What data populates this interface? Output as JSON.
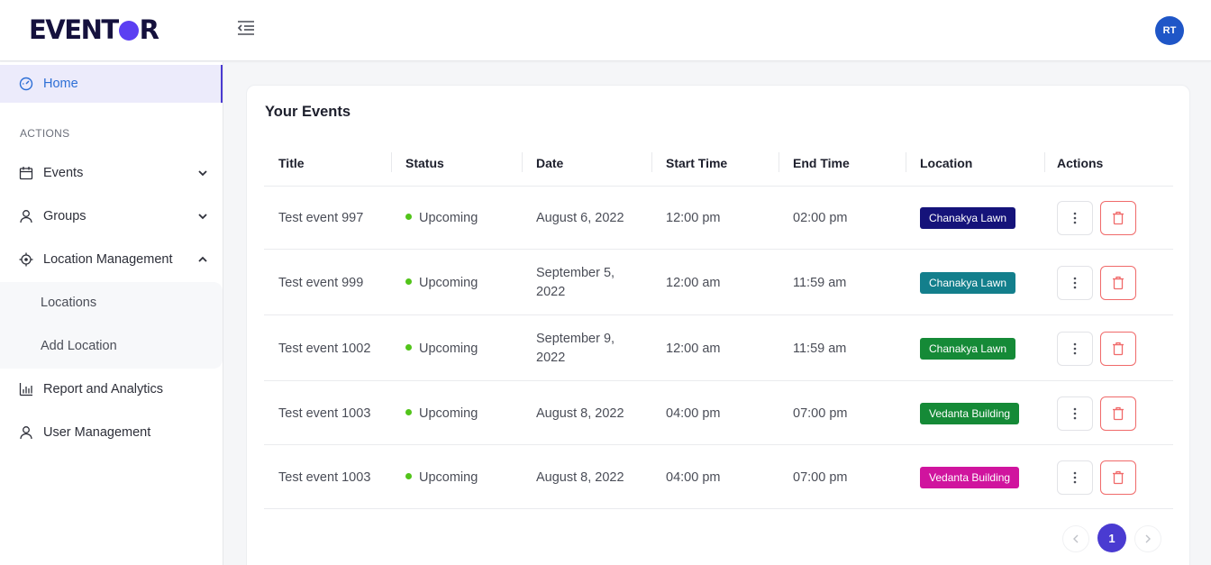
{
  "app": {
    "logo_text_a": "EVENT",
    "logo_text_b": "R",
    "avatar_initials": "RT"
  },
  "sidebar": {
    "home_label": "Home",
    "section_label": "ACTIONS",
    "items": [
      {
        "label": "Events",
        "icon": "calendar-icon",
        "chevron": "down"
      },
      {
        "label": "Groups",
        "icon": "user-icon",
        "chevron": "down"
      },
      {
        "label": "Location Management",
        "icon": "location-target-icon",
        "chevron": "up"
      },
      {
        "label": "Report and Analytics",
        "icon": "bar-chart-icon"
      },
      {
        "label": "User Management",
        "icon": "user-icon"
      }
    ],
    "subitems": [
      "Locations",
      "Add Location"
    ]
  },
  "main": {
    "title": "Your Events",
    "columns": [
      "Title",
      "Status",
      "Date",
      "Start Time",
      "End Time",
      "Location",
      "Actions"
    ],
    "rows": [
      {
        "title": "Test event 997",
        "status": "Upcoming",
        "date_l1": "August 6, 2022",
        "date_l2": "",
        "start": "12:00 pm",
        "end": "02:00 pm",
        "location": "Chanakya Lawn",
        "loc_color": "#15137a"
      },
      {
        "title": "Test event 999",
        "status": "Upcoming",
        "date_l1": "September 5,",
        "date_l2": "2022",
        "start": "12:00 am",
        "end": "11:59 am",
        "location": "Chanakya Lawn",
        "loc_color": "#137f8c"
      },
      {
        "title": "Test event 1002",
        "status": "Upcoming",
        "date_l1": "September 9,",
        "date_l2": "2022",
        "start": "12:00 am",
        "end": "11:59 am",
        "location": "Chanakya Lawn",
        "loc_color": "#158a37"
      },
      {
        "title": "Test event 1003",
        "status": "Upcoming",
        "date_l1": "August 8, 2022",
        "date_l2": "",
        "start": "04:00 pm",
        "end": "07:00 pm",
        "location": "Vedanta Building",
        "loc_color": "#158a37"
      },
      {
        "title": "Test event 1003",
        "status": "Upcoming",
        "date_l1": "August 8, 2022",
        "date_l2": "",
        "start": "04:00 pm",
        "end": "07:00 pm",
        "location": "Vedanta Building",
        "loc_color": "#d0149e"
      }
    ],
    "pagination": {
      "current_page": "1"
    }
  },
  "colors": {
    "accent": "#4a3bd1",
    "danger": "#f06a6a",
    "status_upcoming": "#52c41a",
    "avatar": "#1f56c7"
  }
}
